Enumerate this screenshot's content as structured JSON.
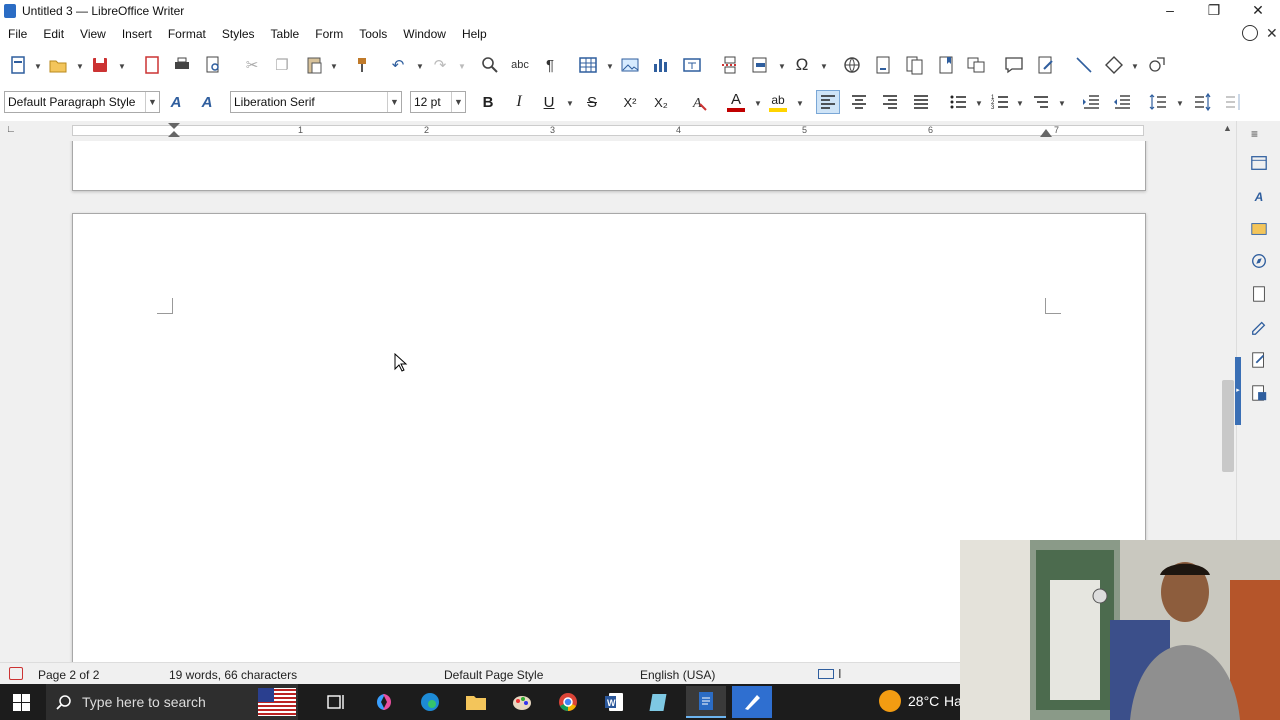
{
  "window": {
    "title": "Untitled 3 — LibreOffice Writer",
    "controls": [
      "–",
      "❐",
      "✕"
    ]
  },
  "menu": [
    "File",
    "Edit",
    "View",
    "Insert",
    "Format",
    "Styles",
    "Table",
    "Form",
    "Tools",
    "Window",
    "Help"
  ],
  "toolbar": {
    "paragraph_style": "Default Paragraph Style",
    "font_name": "Liberation Serif",
    "font_size": "12 pt",
    "bold": "B",
    "italic": "I",
    "underline": "U",
    "strike": "S",
    "superscript": "X²",
    "subscript": "X₂",
    "special_char": "Ω",
    "formatting_marks": "¶",
    "font_color": "#c00000",
    "highlight_color": "#ffd400"
  },
  "ruler": {
    "labels": [
      "1",
      "2",
      "3",
      "4",
      "5",
      "6",
      "7"
    ]
  },
  "status": {
    "page": "Page 2 of 2",
    "words": "19 words, 66 characters",
    "page_style": "Default Page Style",
    "language": "English (USA)"
  },
  "taskbar": {
    "search_placeholder": "Type here to search",
    "weather": "28°C",
    "weather_text": "Ha"
  },
  "colors": {
    "accent": "#2f5e9e",
    "taskbar": "#1c1c1c"
  }
}
